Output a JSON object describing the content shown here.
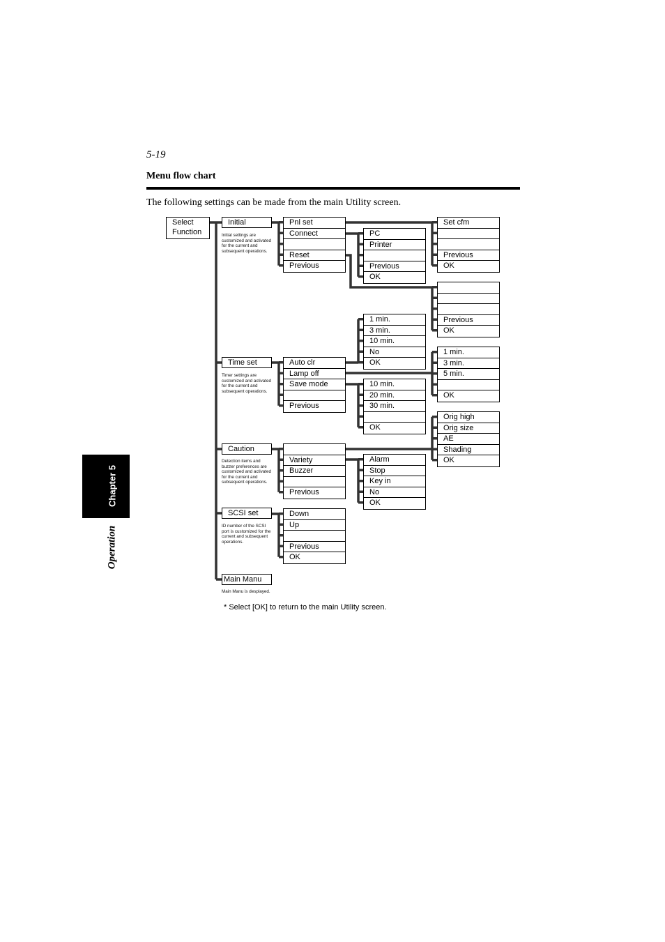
{
  "page": {
    "page_number": "5-19",
    "section_title": "Menu flow chart",
    "intro": "The following settings can be made from the main Utility screen.",
    "chapter_tab": "Chapter 5",
    "chapter_name": "Operation",
    "footnote": "* Select [OK] to return to the main Utility screen."
  },
  "root": {
    "label_line1": "Select",
    "label_line2": "Function"
  },
  "functions": [
    {
      "label": "Initial",
      "description": "Initial settings are customized and activated for the current and subsequent operations."
    },
    {
      "label": "Time set",
      "description": "Timer settings are customized and activated for the current and subsequent operations."
    },
    {
      "label": "Caution",
      "description": "Detection items and buzzer preferences are customized and activated for the current and subsequent operations."
    },
    {
      "label": "SCSI set",
      "description": "ID number of the SCSI port is customized for the current and subsequent operations."
    },
    {
      "label": "Main Manu",
      "description": "Main Manu is desplayed."
    }
  ],
  "submenus": {
    "initial": [
      "Pnl set",
      "Connect",
      "",
      "Reset",
      "Previous"
    ],
    "time_set": [
      "Auto clr",
      "Lamp off",
      "Save mode",
      "",
      "Previous"
    ],
    "caution": [
      "",
      "Variety",
      "Buzzer",
      "",
      "Previous"
    ],
    "scsi_set": [
      "Down",
      "Up",
      "",
      "Previous",
      "OK"
    ]
  },
  "options": {
    "connect": [
      "PC",
      "Printer",
      "",
      "Previous",
      "OK"
    ],
    "pnl_set": [
      "Set cfm",
      "",
      "",
      "Previous",
      "OK"
    ],
    "reset": [
      "",
      "",
      "",
      "Previous",
      "OK"
    ],
    "auto_clr": [
      "1 min.",
      "3 min.",
      "10 min.",
      "No",
      "OK"
    ],
    "lamp_off": [
      "1 min.",
      "3 min.",
      "5 min.",
      "",
      "OK"
    ],
    "save_mode": [
      "10 min.",
      "20 min.",
      "30 min.",
      "",
      "OK"
    ],
    "caution_blank": [
      "Orig high",
      "Orig size",
      "AE",
      "Shading",
      "OK"
    ],
    "variety": [
      "Alarm",
      "Stop",
      "Key in",
      "No",
      "OK"
    ]
  }
}
